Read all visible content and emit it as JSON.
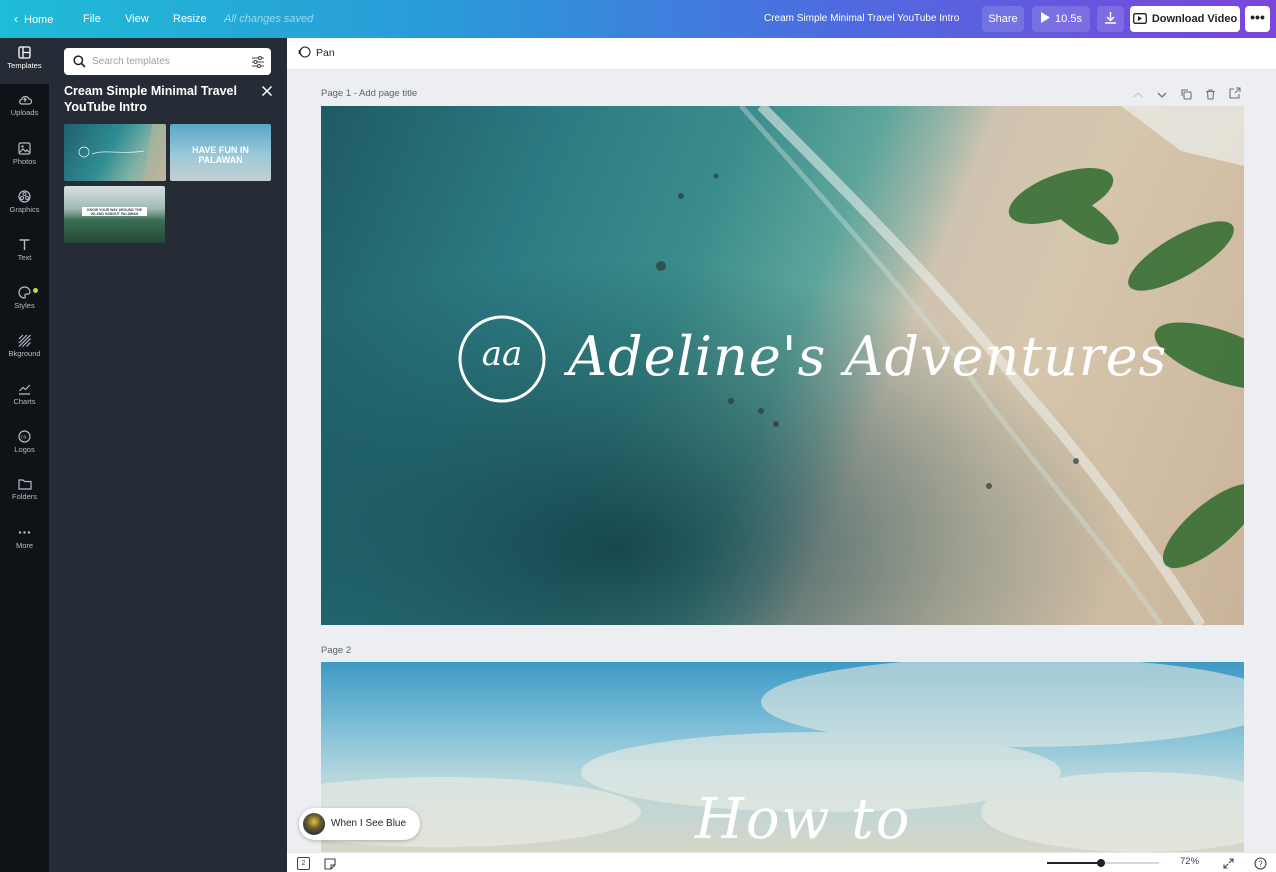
{
  "topbar": {
    "home": "Home",
    "menu": [
      "File",
      "View",
      "Resize"
    ],
    "saved_status": "All changes saved",
    "design_title": "Cream Simple Minimal Travel YouTube Intro",
    "share": "Share",
    "duration": "10.5s",
    "download_video": "Download Video"
  },
  "rail": {
    "items": [
      "Templates",
      "Uploads",
      "Photos",
      "Graphics",
      "Text",
      "Styles",
      "Bkground",
      "Charts",
      "Logos",
      "Folders",
      "More"
    ]
  },
  "panel": {
    "search_placeholder": "Search templates",
    "title": "Cream Simple Minimal Travel YouTube Intro",
    "thumb2_text": "HAVE FUN IN PALAWAN",
    "thumb3_text": "KNOW YOUR WAY AROUND THE ISLAND HABOUT PALAWAN"
  },
  "toolbar": {
    "pan": "Pan"
  },
  "page1": {
    "label": "Page 1 - Add page title",
    "monogram": "aa",
    "title": "Adeline's Adventures"
  },
  "page2": {
    "label": "Page 2",
    "title": "How to"
  },
  "music": {
    "track": "When I See Blue"
  },
  "bottombar": {
    "page_count": "2",
    "zoom": "72%",
    "zoom_level": 0.48
  }
}
